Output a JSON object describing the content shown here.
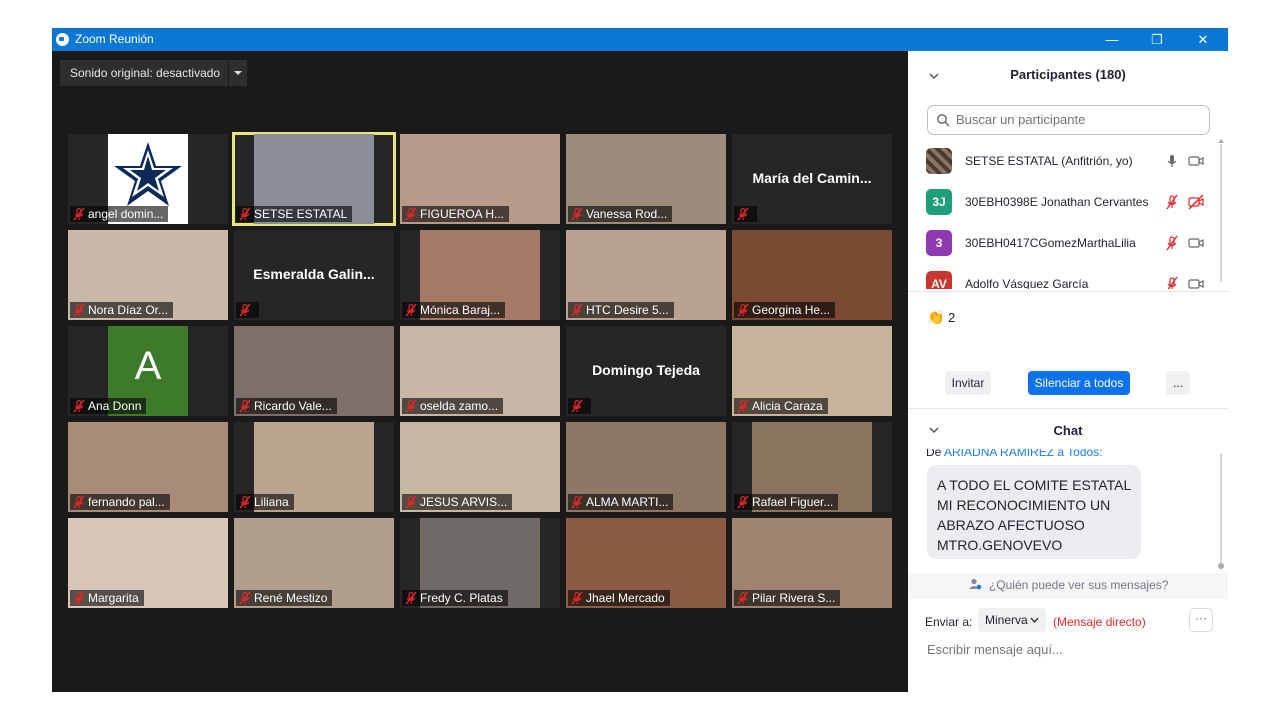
{
  "window": {
    "title": "Zoom Reunión",
    "controls": {
      "minimize": "—",
      "restore": "❐",
      "close": "✕"
    }
  },
  "video": {
    "sound_label": "Sonido original: desactivado",
    "tiles": [
      {
        "name": "angel domin...",
        "type": "logo",
        "bg": "#ffffff",
        "muted": true
      },
      {
        "name": "SETSE ESTATAL",
        "type": "video",
        "bg": "#8a8f97",
        "muted": true,
        "active": true
      },
      {
        "name": "FIGUEROA H...",
        "type": "video",
        "bg": "#b89a8b",
        "muted": true
      },
      {
        "name": "Vanessa Rod...",
        "type": "video",
        "bg": "#9b8c7c",
        "muted": true
      },
      {
        "name": "",
        "type": "name",
        "big": "María del Camin...",
        "muted": true
      },
      {
        "name": "Nora Díaz Or...",
        "type": "video",
        "bg": "#c7b8a8",
        "muted": true
      },
      {
        "name": "",
        "type": "name",
        "big": "Esmeralda Galin...",
        "muted": true
      },
      {
        "name": "Mónica Baraj...",
        "type": "video",
        "bg": "#a47a66",
        "muted": true
      },
      {
        "name": "HTC Desire 5...",
        "type": "video",
        "bg": "#b9a291",
        "muted": true
      },
      {
        "name": "Georgina He...",
        "type": "video",
        "bg": "#7a4a34",
        "muted": true
      },
      {
        "name": "Ana Donn",
        "type": "avatar",
        "letter": "A",
        "bg": "#3d7a2a",
        "muted": true
      },
      {
        "name": "Ricardo Vale...",
        "type": "video",
        "bg": "#7d6f6a",
        "muted": true
      },
      {
        "name": "oselda zamo...",
        "type": "video",
        "bg": "#c9b6a6",
        "muted": true
      },
      {
        "name": "",
        "type": "name",
        "big": "Domingo Tejeda",
        "muted": true
      },
      {
        "name": "Alicia Caraza",
        "type": "video",
        "bg": "#c8b49a",
        "muted": true
      },
      {
        "name": "fernando pal...",
        "type": "video",
        "bg": "#a88b78",
        "muted": true
      },
      {
        "name": "Liliana",
        "type": "video",
        "bg": "#b9a48f",
        "muted": true
      },
      {
        "name": "JESUS ARVIS...",
        "type": "video",
        "bg": "#c7b8a3",
        "muted": true
      },
      {
        "name": "ALMA MARTI...",
        "type": "video",
        "bg": "#8d7866",
        "muted": true
      },
      {
        "name": "Rafael Figuer...",
        "type": "video",
        "bg": "#8c7560",
        "muted": true
      },
      {
        "name": "Margarita",
        "type": "video",
        "bg": "#d7c6b9",
        "muted": true
      },
      {
        "name": "René Mestizo",
        "type": "video",
        "bg": "#b29e8c",
        "muted": true
      },
      {
        "name": "Fredy C. Platas",
        "type": "video",
        "bg": "#6f6a66",
        "muted": true
      },
      {
        "name": "Jhael Mercado",
        "type": "video",
        "bg": "#8a5c45",
        "muted": true
      },
      {
        "name": "Pilar Rivera S...",
        "type": "video",
        "bg": "#a08470",
        "muted": true
      }
    ]
  },
  "participants": {
    "title": "Participantes (180)",
    "search_placeholder": "Buscar un participante",
    "items": [
      {
        "name": "SETSE ESTATAL (Anfitrión, yo)",
        "avatar": "",
        "avatar_bg": "#6d5a4a",
        "mic": "on",
        "video": "off"
      },
      {
        "name": "30EBH0398E Jonathan Cervantes",
        "avatar": "3J",
        "avatar_bg": "#1f9e7a",
        "mic": "muted",
        "video": "off-red"
      },
      {
        "name": "30EBH0417CGomezMarthaLilia",
        "avatar": "3",
        "avatar_bg": "#8e3ab0",
        "mic": "muted",
        "video": "off"
      },
      {
        "name": "Adolfo Vásquez García",
        "avatar": "AV",
        "avatar_bg": "#c8372d",
        "mic": "muted",
        "video": "off"
      }
    ],
    "reaction_emoji": "👏",
    "reaction_count": "2",
    "invite_label": "Invitar",
    "mute_all_label": "Silenciar a todos",
    "more_label": "..."
  },
  "chat": {
    "title": "Chat",
    "from_prefix": "De",
    "from_name": "ARIADNA RAMIREZ",
    "to_text": "a Todos:",
    "message_lines": [
      "A TODO EL COMITE ESTATAL",
      "MI RECONOCIMIENTO UN",
      "ABRAZO AFECTUOSO",
      "MTRO.GENOVEVO"
    ],
    "who_can_see": "¿Quién puede ver sus mensajes?",
    "send_to_label": "Enviar a:",
    "recipient": "Minerva",
    "direct_label": "(Mensaje directo)",
    "more_label": "···",
    "input_placeholder": "Escribir mensaje aquí..."
  },
  "colors": {
    "titlebar": "#0b78d6",
    "accent_blue": "#0e72ed",
    "muted_red": "#e02828",
    "active_speaker": "#e6e67a"
  }
}
